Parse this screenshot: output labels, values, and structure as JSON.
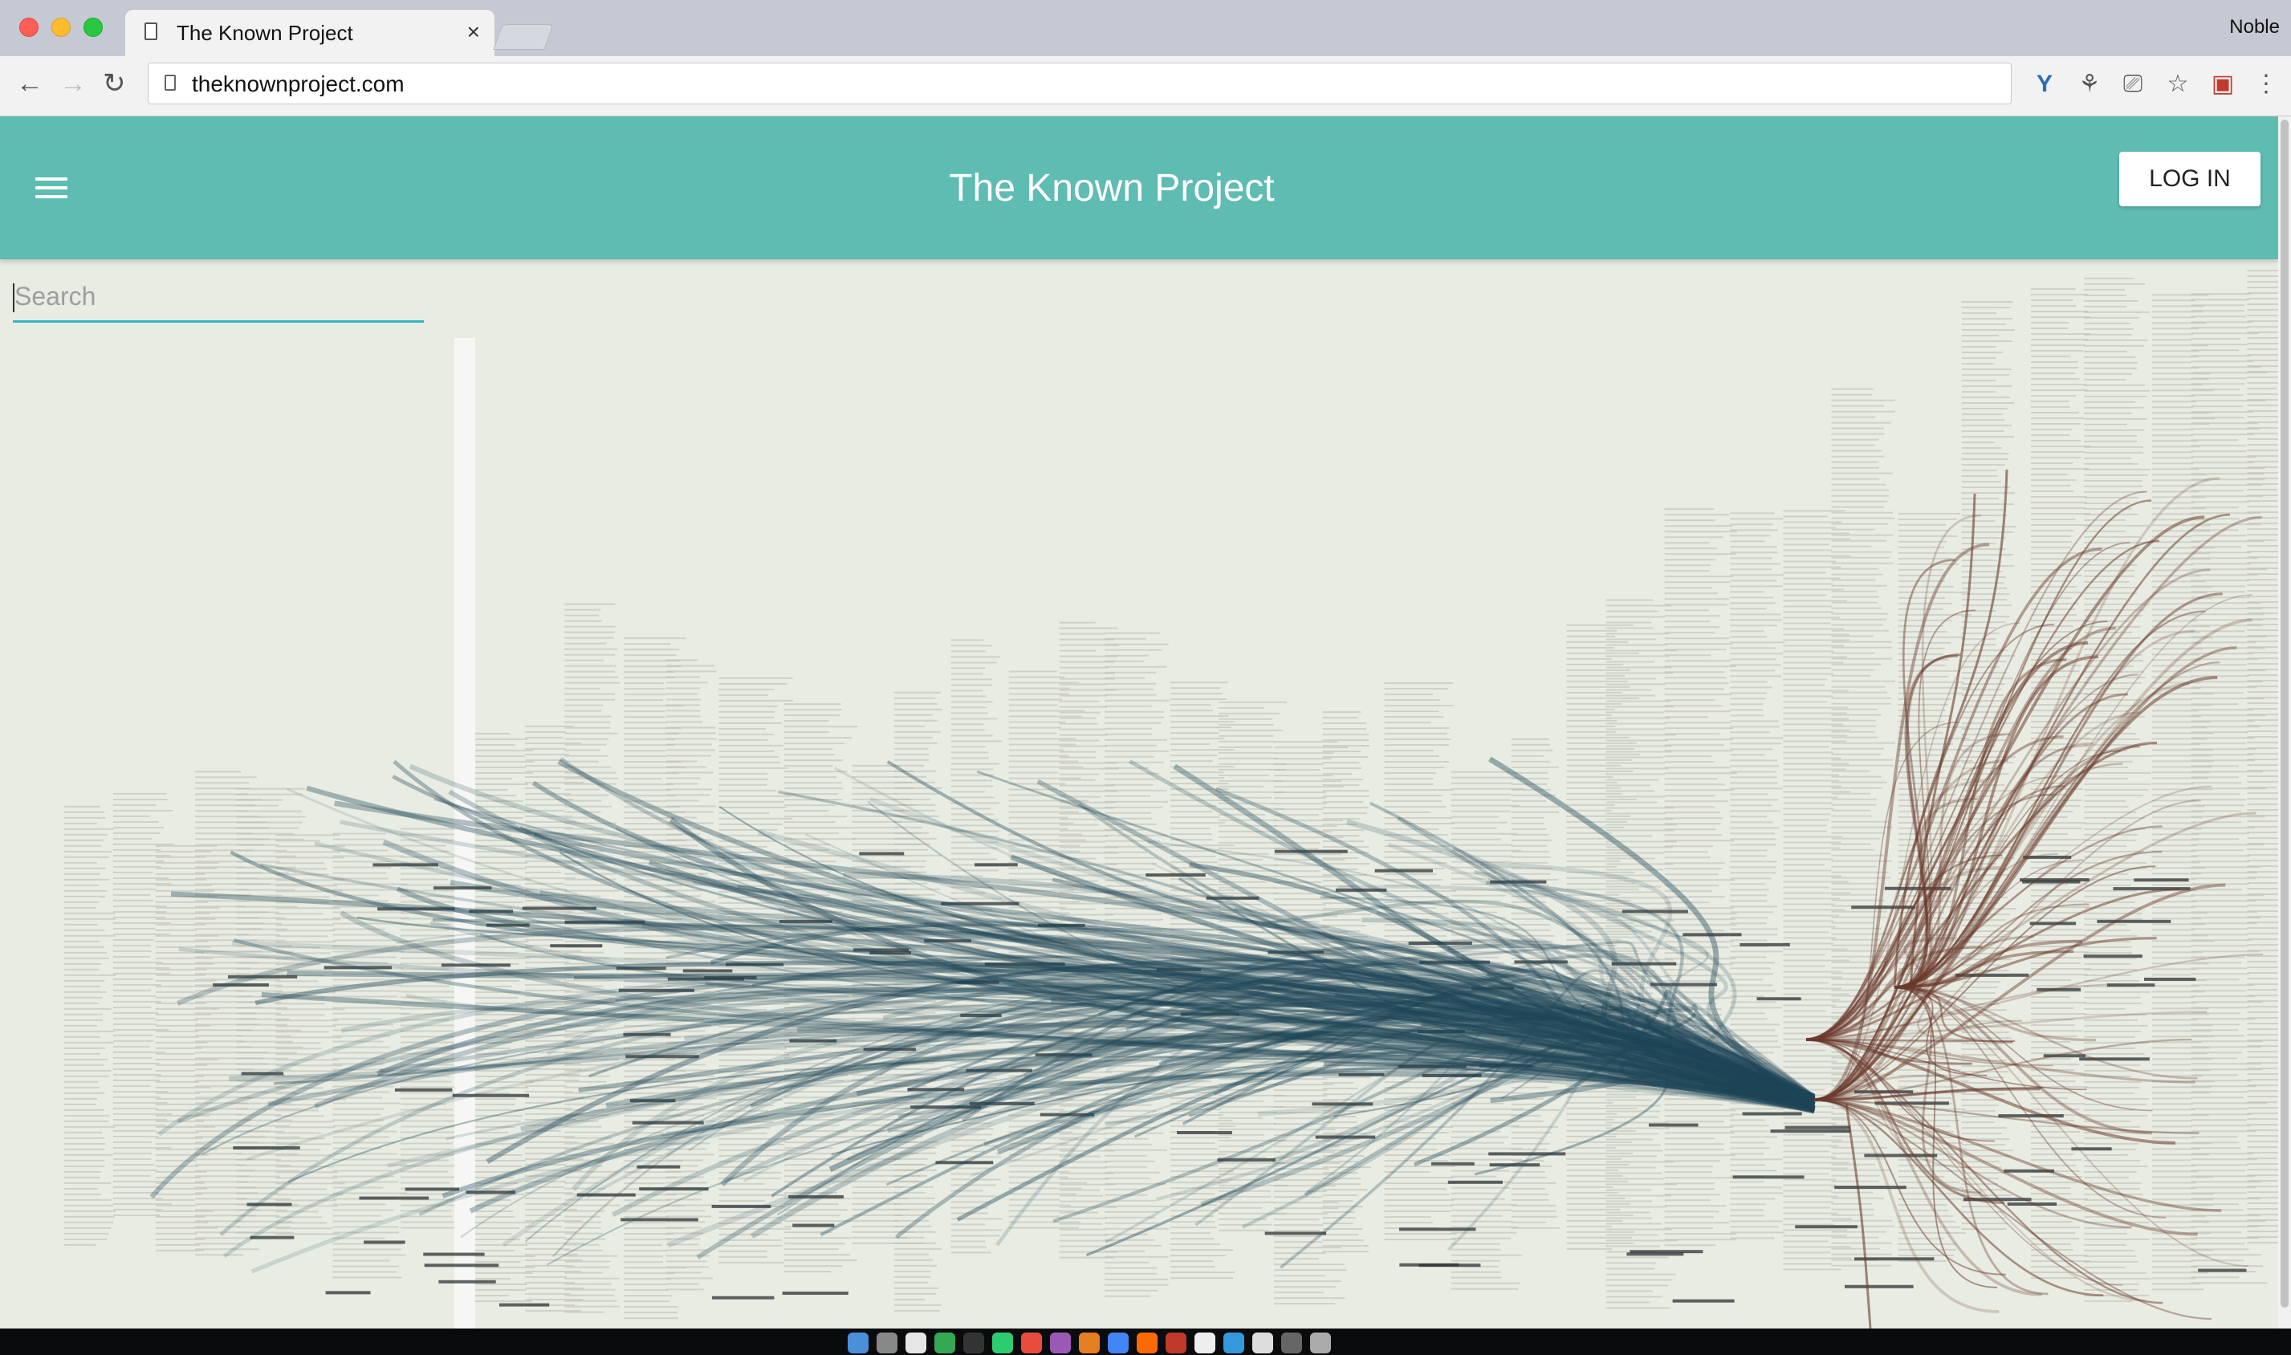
{
  "browser": {
    "tab_title": "The Known Project",
    "tab_close": "×",
    "profile_name": "Noble",
    "url": "theknownproject.com",
    "nav": {
      "back": "←",
      "forward": "→",
      "reload": "↻"
    },
    "extensions": [
      "Y",
      "⚘",
      "⎚",
      "☆",
      "▣",
      "⋮"
    ]
  },
  "app": {
    "title": "The Known Project",
    "login_label": "LOG IN",
    "accent_color": "#5ebcb2",
    "search": {
      "placeholder": "Search",
      "value": ""
    }
  },
  "visualization": {
    "left_stream_color": "#1f4658",
    "right_stream_color": "#6b3a2c",
    "background_color": "#e8ece2"
  }
}
